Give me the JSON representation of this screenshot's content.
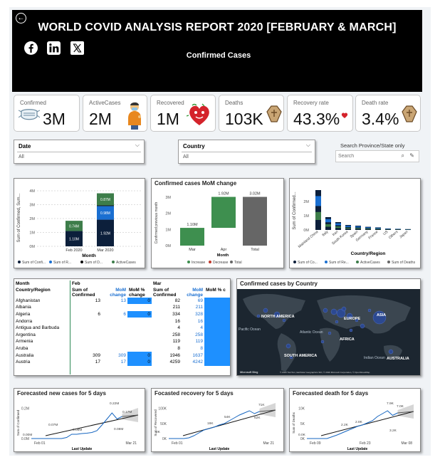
{
  "header": {
    "title": "WORLD COVID ANALYSIS REPORT 2020 [FEBRUARY & MARCH]",
    "subtitle": "Confirmed Cases",
    "social": [
      "facebook-icon",
      "linkedin-icon",
      "x-icon"
    ]
  },
  "kpis": [
    {
      "label": "Confirmed",
      "value": "3M",
      "icon": "mask-icon"
    },
    {
      "label": "ActiveCases",
      "value": "2M",
      "icon": "person-icon"
    },
    {
      "label": "Recovered",
      "value": "1M",
      "icon": "heart-icon"
    },
    {
      "label": "Deaths",
      "value": "103K",
      "icon": "coffin-icon"
    },
    {
      "label": "Recovery rate",
      "value": "43.3%",
      "icon": "heart-icon"
    },
    {
      "label": "Death rate",
      "value": "3.4%",
      "icon": "coffin-icon"
    }
  ],
  "filters": {
    "date": {
      "label": "Date",
      "value": "All"
    },
    "country": {
      "label": "Country",
      "value": "All"
    },
    "search": {
      "label": "Search Province/State only",
      "placeholder": "Search"
    }
  },
  "colors": {
    "confirmed": "#3d7d4a",
    "recovered": "#1a6fd1",
    "deaths": "#0c1f3b",
    "active": "#a9c9b4",
    "increase": "#3e8f4f",
    "total": "#666666",
    "bars": "#1e90ff"
  },
  "chart_data": [
    {
      "type": "bar",
      "title": "",
      "xlabel": "Month",
      "ylabel": "Sum of Confirmed, Sum...",
      "categories": [
        "Feb 2020",
        "Mar 2020"
      ],
      "ylim": [
        0,
        4
      ],
      "yticks": [
        "0M",
        "1M",
        "2M",
        "3M",
        "4M"
      ],
      "series": [
        {
          "name": "Sum of Confi...",
          "values": [
            1.1,
            1.92
          ],
          "labels": [
            "1.10M",
            "1.92M"
          ]
        },
        {
          "name": "Sum of R...",
          "values": [
            0.0,
            0.98
          ],
          "labels": [
            "",
            "0.98M"
          ]
        },
        {
          "name": "Sum of D...",
          "values": [
            0.0,
            0.05
          ],
          "labels": [
            "",
            ""
          ]
        },
        {
          "name": "ActiveCases",
          "values": [
            0.74,
            0.87
          ],
          "labels": [
            "0.74M",
            "0.87M"
          ]
        }
      ],
      "legend": [
        "Sum of Confi...",
        "Sum of R...",
        "Sum of D...",
        "ActiveCases"
      ]
    },
    {
      "type": "bar",
      "title": "Confirmed cases MoM change",
      "xlabel": "Month",
      "ylabel": "Confirmed previous month",
      "categories": [
        "Mar",
        "Apr",
        "Total"
      ],
      "ylim": [
        0,
        3
      ],
      "yticks": [
        "0M",
        "1M",
        "2M",
        "3M"
      ],
      "values": [
        1.1,
        1.92,
        3.02
      ],
      "labels": [
        "1.10M",
        "1.92M",
        "3.02M"
      ],
      "legend": [
        "Increase",
        "Decrease",
        "Total"
      ]
    },
    {
      "type": "bar",
      "title": "",
      "xlabel": "Country/Region",
      "ylabel": "Sum of Confirmed...",
      "categories": [
        "Mainland China",
        "Italy",
        "Iran",
        "South Korea",
        "Spain",
        "Germany",
        "France",
        "US",
        "Others",
        "Japan"
      ],
      "ylim": [
        0,
        3
      ],
      "yticks": [
        "0M",
        "1M",
        "2M"
      ],
      "values": [
        2.8,
        0.9,
        0.55,
        0.35,
        0.3,
        0.22,
        0.18,
        0.1,
        0.08,
        0.06
      ],
      "legend": [
        "Sum of Co...",
        "Sum of Re...",
        "ActiveCases",
        "Sum of Deaths"
      ]
    },
    {
      "type": "line",
      "title": "Forecasted new cases for 5 days",
      "xlabel": "Last Update",
      "ylabel": "Sum of Confirmed",
      "x": [
        "Feb 01",
        "Mar 21"
      ],
      "yticks": [
        "0.0M",
        "0.2M"
      ],
      "annotations": [
        "0.00M",
        "0.07M",
        "0.08M",
        "0.08M",
        "0.22M",
        "0.17M"
      ]
    },
    {
      "type": "line",
      "title": "Focasted recovery for 5 days",
      "xlabel": "Last Update",
      "ylabel": "Sum of Recovered",
      "x": [
        "Feb 01",
        "Mar 21"
      ],
      "yticks": [
        "0K",
        "50K",
        "100K"
      ],
      "annotations": [
        "0K",
        "19K",
        "54K",
        "62K",
        "71K"
      ]
    },
    {
      "type": "line",
      "title": "Forecasted death for 5 days",
      "xlabel": "Last Update",
      "ylabel": "Sum of Deaths",
      "x": [
        "Feb 09",
        "Feb 23",
        "Mar 08"
      ],
      "yticks": [
        "0K",
        "5K",
        "10K"
      ],
      "annotations": [
        "0.0K",
        "2.2K",
        "2.8K",
        "3.2K",
        "7.9K",
        "7.0K"
      ]
    }
  ],
  "table": {
    "h1": [
      "Month",
      "Feb",
      "Mar"
    ],
    "h2": [
      "Country/Region",
      "Sum of Confirmed",
      "MoM change",
      "MoM % change",
      "Sum of Confirmed",
      "MoM change",
      "MoM % c"
    ],
    "rows": [
      [
        "Afghanistan",
        "13",
        "13",
        "0",
        "82",
        "69"
      ],
      [
        "Albania",
        "",
        "",
        "",
        "211",
        "211"
      ],
      [
        "Algeria",
        "6",
        "6",
        "0",
        "334",
        "328"
      ],
      [
        "Andorra",
        "",
        "",
        "",
        "16",
        "16"
      ],
      [
        "Antigua and Barbuda",
        "",
        "",
        "",
        "4",
        "4"
      ],
      [
        "Argentina",
        "",
        "",
        "",
        "258",
        "258"
      ],
      [
        "Armenia",
        "",
        "",
        "",
        "119",
        "119"
      ],
      [
        "Aruba",
        "",
        "",
        "",
        "8",
        "8"
      ],
      [
        "Australia",
        "309",
        "309",
        "0",
        "1946",
        "1637"
      ],
      [
        "Austria",
        "17",
        "17",
        "0",
        "4259",
        "4242"
      ]
    ]
  },
  "map": {
    "title": "Confirmed cases by Country",
    "labels": [
      "NORTH AMERICA",
      "ASIA",
      "Pacific Ocean",
      "Atlantic Ocean",
      "EUROPE",
      "AFRICA",
      "SOUTH AMERICA",
      "Indian Ocean",
      "AUSTRALIA"
    ],
    "brand": "Microsoft Bing",
    "credit": "© 2020 TomTom, Earthstar Geographics SIO, © 2020 Microsoft Corporation, © OpenStreetMap"
  }
}
